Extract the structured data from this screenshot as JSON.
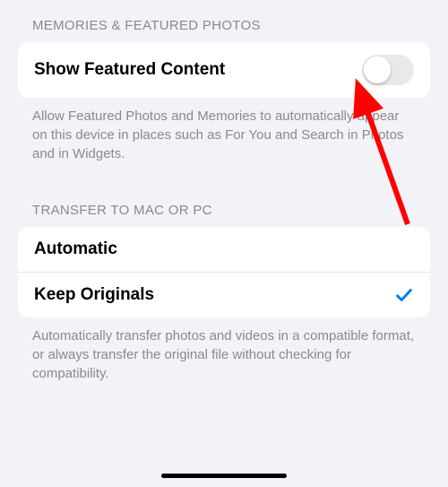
{
  "section1": {
    "header": "MEMORIES & FEATURED PHOTOS",
    "toggle_label": "Show Featured Content",
    "toggle_on": false,
    "footer": "Allow Featured Photos and Memories to automatically appear on this device in places such as For You and Search in Photos and in Widgets."
  },
  "section2": {
    "header": "TRANSFER TO MAC OR PC",
    "option1": "Automatic",
    "option2": "Keep Originals",
    "selected_index": 1,
    "footer": "Automatically transfer photos and videos in a compatible format, or always transfer the original file without checking for compatibility."
  },
  "colors": {
    "check": "#007aff",
    "arrow": "#ff0000"
  }
}
